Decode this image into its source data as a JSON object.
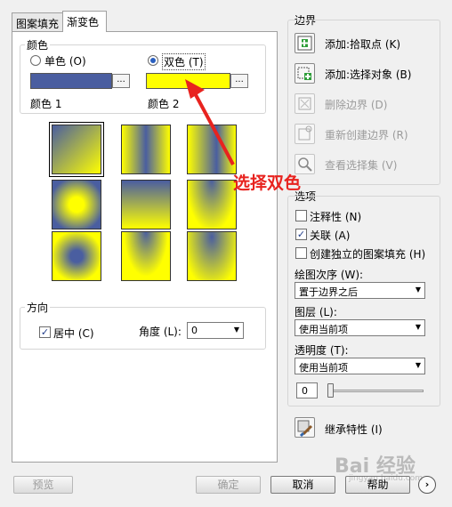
{
  "tabs": {
    "hatch": "图案填充",
    "gradient": "渐变色"
  },
  "color": {
    "title": "颜色",
    "single": "单色 (O)",
    "dual": "双色 (T)",
    "color1_label": "颜色 1",
    "color2_label": "颜色 2",
    "browse": "...",
    "color1_hex": "#4a5ea0",
    "color2_hex": "#ffff00"
  },
  "orientation": {
    "title": "方向",
    "centered": "居中 (C)",
    "angle_label": "角度 (L):",
    "angle_value": "0"
  },
  "boundaries": {
    "title": "边界",
    "add_pick": "添加:拾取点 (K)",
    "add_select": "添加:选择对象 (B)",
    "remove": "删除边界 (D)",
    "recreate": "重新创建边界 (R)",
    "view": "查看选择集 (V)"
  },
  "options": {
    "title": "选项",
    "annotative": "注释性 (N)",
    "associative": "关联 (A)",
    "separate": "创建独立的图案填充 (H)",
    "draw_order_label": "绘图次序 (W):",
    "draw_order_value": "置于边界之后",
    "layer_label": "图层 (L):",
    "layer_value": "使用当前项",
    "transparency_label": "透明度 (T):",
    "transparency_value": "使用当前项",
    "transparency_num": "0",
    "transparency_level": 0
  },
  "inherit": "继承特性 (I)",
  "annotation": "选择双色",
  "buttons": {
    "preview": "预览",
    "ok": "确定",
    "cancel": "取消",
    "help": "帮助"
  },
  "watermark": "Bai 经验",
  "watermark_sub": "jingyan.baidu.com"
}
